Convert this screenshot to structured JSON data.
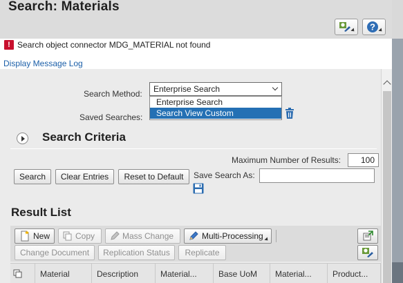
{
  "header": {
    "title": "Search: Materials"
  },
  "message": {
    "icon": "error-icon",
    "icon_glyph": "!",
    "text": "Search object connector MDG_MATERIAL not found",
    "link": "Display Message Log"
  },
  "search": {
    "method_label": "Search Method:",
    "method_value": "Enterprise Search",
    "method_options": [
      "Enterprise Search",
      "Search View Custom"
    ],
    "saved_label": "Saved Searches:"
  },
  "criteria": {
    "title": "Search Criteria",
    "max_results_label": "Maximum Number of Results:",
    "max_results_value": "100",
    "buttons": {
      "search": "Search",
      "clear": "Clear Entries",
      "reset": "Reset to Default"
    },
    "save_as_label": "Save Search As:"
  },
  "results": {
    "title": "Result List",
    "toolbar": {
      "new": "New",
      "copy": "Copy",
      "mass_change": "Mass Change",
      "multi_processing": "Multi-Processing",
      "change_document": "Change Document",
      "replication_status": "Replication Status",
      "replicate": "Replicate"
    },
    "columns": [
      "Material",
      "Description",
      "Material...",
      "Base UoM",
      "Material...",
      "Product..."
    ]
  },
  "colors": {
    "accent": "#2470b4",
    "error": "#c8102e",
    "link": "#1a5ea8"
  }
}
